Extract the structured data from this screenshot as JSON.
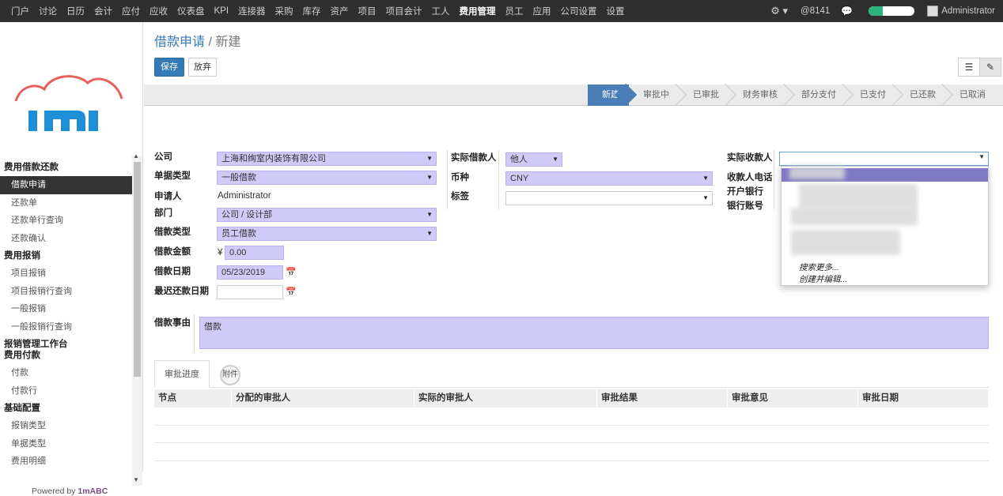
{
  "topnav": [
    "门户",
    "讨论",
    "日历",
    "会计",
    "应付",
    "应收",
    "仪表盘",
    "KPI",
    "连接器",
    "采购",
    "库存",
    "资产",
    "项目",
    "项目会计",
    "工人",
    "费用管理",
    "员工",
    "应用",
    "公司设置",
    "设置"
  ],
  "topnav_active": "费用管理",
  "topbar": {
    "mentions": "@8141",
    "user": "Administrator"
  },
  "sidebar": {
    "sections": [
      {
        "title": "费用借款还款",
        "items": [
          "借款申请",
          "还款单",
          "还款单行查询",
          "还款确认"
        ]
      },
      {
        "title": "费用报销",
        "items": [
          "项目报销",
          "项目报销行查询",
          "一般报销",
          "一般报销行查询"
        ]
      },
      {
        "title": "报销管理工作台",
        "items": []
      },
      {
        "title": "费用付款",
        "items": [
          "付款",
          "付款行"
        ]
      },
      {
        "title": "基础配置",
        "items": [
          "报销类型",
          "单据类型",
          "费用明细"
        ]
      }
    ],
    "selected": "借款申请",
    "powered_prefix": "Powered by ",
    "powered_brand": "1mABC"
  },
  "breadcrumb": {
    "parent": "借款申请",
    "sep": "/",
    "current": "新建"
  },
  "buttons": {
    "save": "保存",
    "discard": "放弃"
  },
  "stages": [
    "新建",
    "审批中",
    "已审批",
    "财务审核",
    "部分支付",
    "已支付",
    "已还款",
    "已取消"
  ],
  "current_stage": "新建",
  "form": {
    "company_label": "公司",
    "company": "上海和绚室内装饰有限公司",
    "doctype_label": "单据类型",
    "doctype": "一般借款",
    "applicant_label": "申请人",
    "applicant": "Administrator",
    "dept_label": "部门",
    "dept": "公司 / 设计部",
    "loantype_label": "借款类型",
    "loantype": "员工借款",
    "amount_label": "借款金额",
    "currency_symbol": "¥",
    "amount": "0.00",
    "date_label": "借款日期",
    "date": "05/23/2019",
    "latest_label": "最迟还款日期",
    "latest": "",
    "actual_borrower_label": "实际借款人",
    "actual_borrower": "他人",
    "currency_label": "币种",
    "currency": "CNY",
    "tag_label": "标签",
    "tag": "",
    "payee_label": "实际收款人",
    "payee": "",
    "payee_phone_label": "收款人电话",
    "bank_label": "开户银行",
    "account_label": "银行账号",
    "reason_label": "借款事由",
    "reason": "借款"
  },
  "dropdown": {
    "search_more": "搜索更多...",
    "create_edit": "创建并编辑..."
  },
  "tabs": [
    "审批进度",
    "附件"
  ],
  "table": {
    "columns": [
      "节点",
      "分配的审批人",
      "实际的审批人",
      "审批结果",
      "审批意见",
      "审批日期"
    ]
  }
}
